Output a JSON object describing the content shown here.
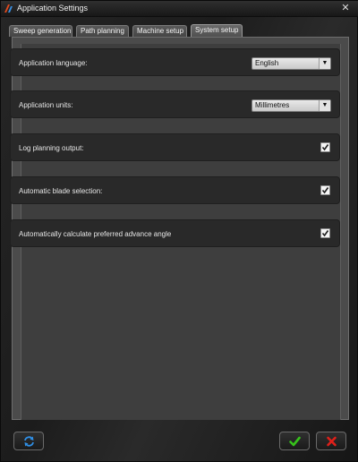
{
  "window": {
    "title": "Application Settings",
    "close_glyph": "✕",
    "app_icon": "app-logo-icon"
  },
  "tabs": [
    {
      "label": "Sweep generation",
      "active": false
    },
    {
      "label": "Path planning",
      "active": false
    },
    {
      "label": "Machine setup",
      "active": false
    },
    {
      "label": "System setup",
      "active": true
    }
  ],
  "settings": {
    "language": {
      "label": "Application language:",
      "value": "English"
    },
    "units": {
      "label": "Application units:",
      "value": "Millimetres"
    },
    "log_planning": {
      "label": "Log planning output:",
      "checked": true
    },
    "auto_blade": {
      "label": "Automatic blade selection:",
      "checked": true
    },
    "auto_advance_angle": {
      "label": "Automatically calculate preferred advance angle",
      "checked": true
    }
  },
  "buttons": {
    "reset": {
      "icon": "refresh-icon"
    },
    "ok": {
      "icon": "checkmark-icon",
      "color": "#36c21b"
    },
    "cancel": {
      "icon": "x-icon",
      "color": "#e0201a"
    }
  },
  "colors": {
    "checkbox_tick": "#1a1a1a"
  }
}
